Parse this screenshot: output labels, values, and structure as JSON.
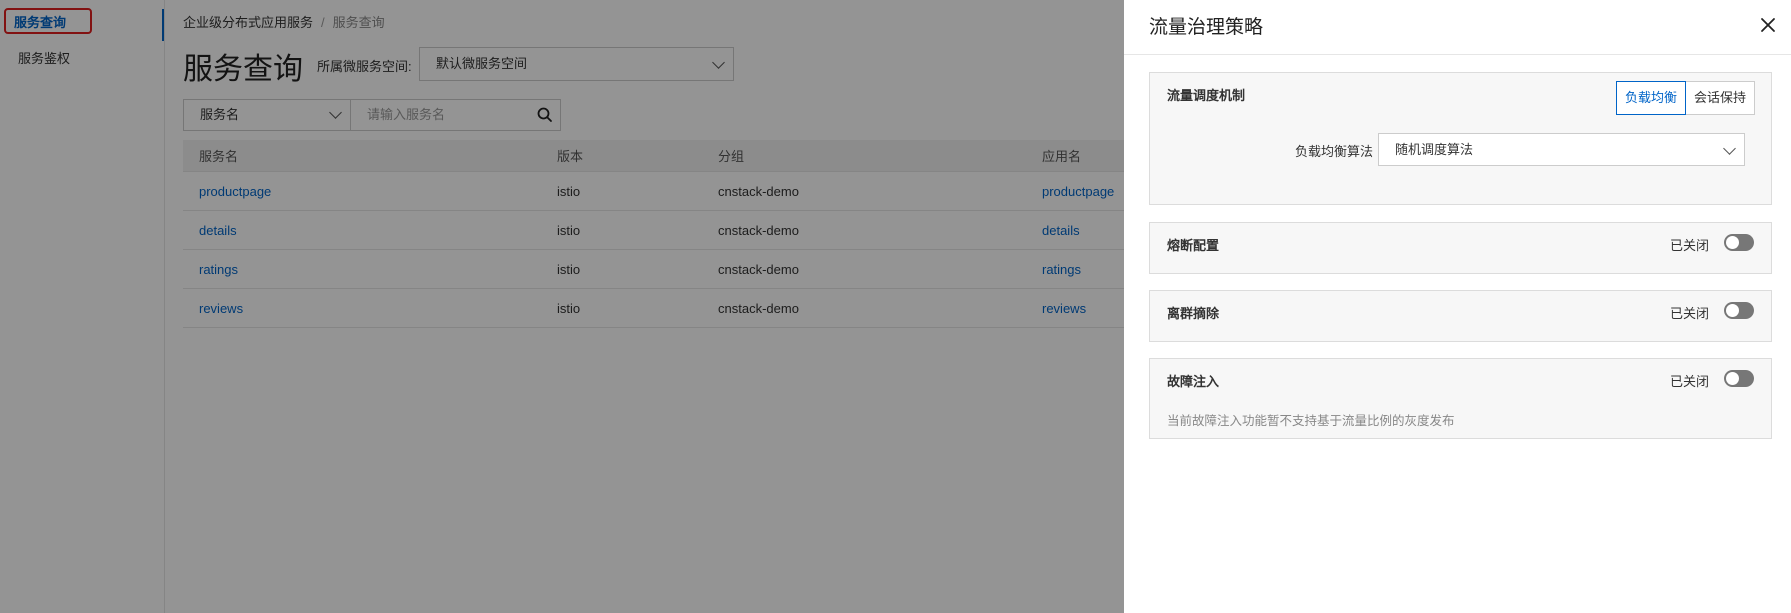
{
  "nav": {
    "items": [
      {
        "label": "服务查询"
      },
      {
        "label": "服务鉴权"
      }
    ]
  },
  "breadcrumb": {
    "parent": "企业级分布式应用服务",
    "separator": "/",
    "current": "服务查询"
  },
  "page": {
    "title": "服务查询",
    "namespace_label": "所属微服务空间:",
    "namespace_value": "默认微服务空间"
  },
  "filter": {
    "field": "服务名",
    "search_placeholder": "请输入服务名"
  },
  "table": {
    "columns": [
      "服务名",
      "版本",
      "分组",
      "应用名"
    ],
    "rows": [
      {
        "name": "productpage",
        "version": "istio",
        "group": "cnstack-demo",
        "app": "productpage"
      },
      {
        "name": "details",
        "version": "istio",
        "group": "cnstack-demo",
        "app": "details"
      },
      {
        "name": "ratings",
        "version": "istio",
        "group": "cnstack-demo",
        "app": "ratings"
      },
      {
        "name": "reviews",
        "version": "istio",
        "group": "cnstack-demo",
        "app": "reviews"
      }
    ]
  },
  "drawer": {
    "title": "流量治理策略",
    "traffic": {
      "title": "流量调度机制",
      "options": [
        "负载均衡",
        "会话保持"
      ],
      "algo_label": "负载均衡算法",
      "algo_value": "随机调度算法"
    },
    "circuit": {
      "title": "熔断配置",
      "status": "已关闭"
    },
    "outlier": {
      "title": "离群摘除",
      "status": "已关闭"
    },
    "fault": {
      "title": "故障注入",
      "status": "已关闭",
      "note": "当前故障注入功能暂不支持基于流量比例的灰度发布"
    }
  },
  "colors": {
    "accent": "#0064c8",
    "highlight_border": "#e02020",
    "overlay": "rgba(0,0,0,0.42)"
  }
}
